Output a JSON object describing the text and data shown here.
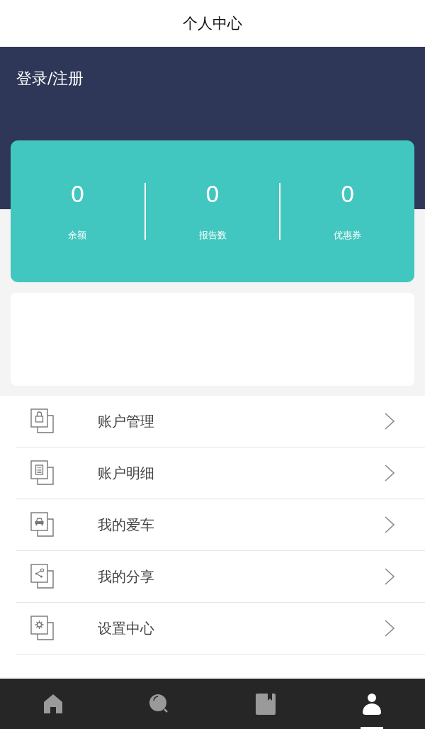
{
  "header": {
    "title": "个人中心"
  },
  "banner": {
    "login_link": "登录/注册"
  },
  "stats": [
    {
      "value": "0",
      "label": "余额"
    },
    {
      "value": "0",
      "label": "报告数"
    },
    {
      "value": "0",
      "label": "优惠券"
    }
  ],
  "menu": [
    {
      "kind": "lock",
      "label": "账户管理"
    },
    {
      "kind": "document",
      "label": "账户明细"
    },
    {
      "kind": "car",
      "label": "我的爱车"
    },
    {
      "kind": "share",
      "label": "我的分享"
    },
    {
      "kind": "gear",
      "label": "设置中心"
    }
  ],
  "tab_bar": [
    {
      "kind": "home",
      "selected": false
    },
    {
      "kind": "search",
      "selected": false
    },
    {
      "kind": "book",
      "selected": false
    },
    {
      "kind": "user",
      "selected": true
    }
  ]
}
